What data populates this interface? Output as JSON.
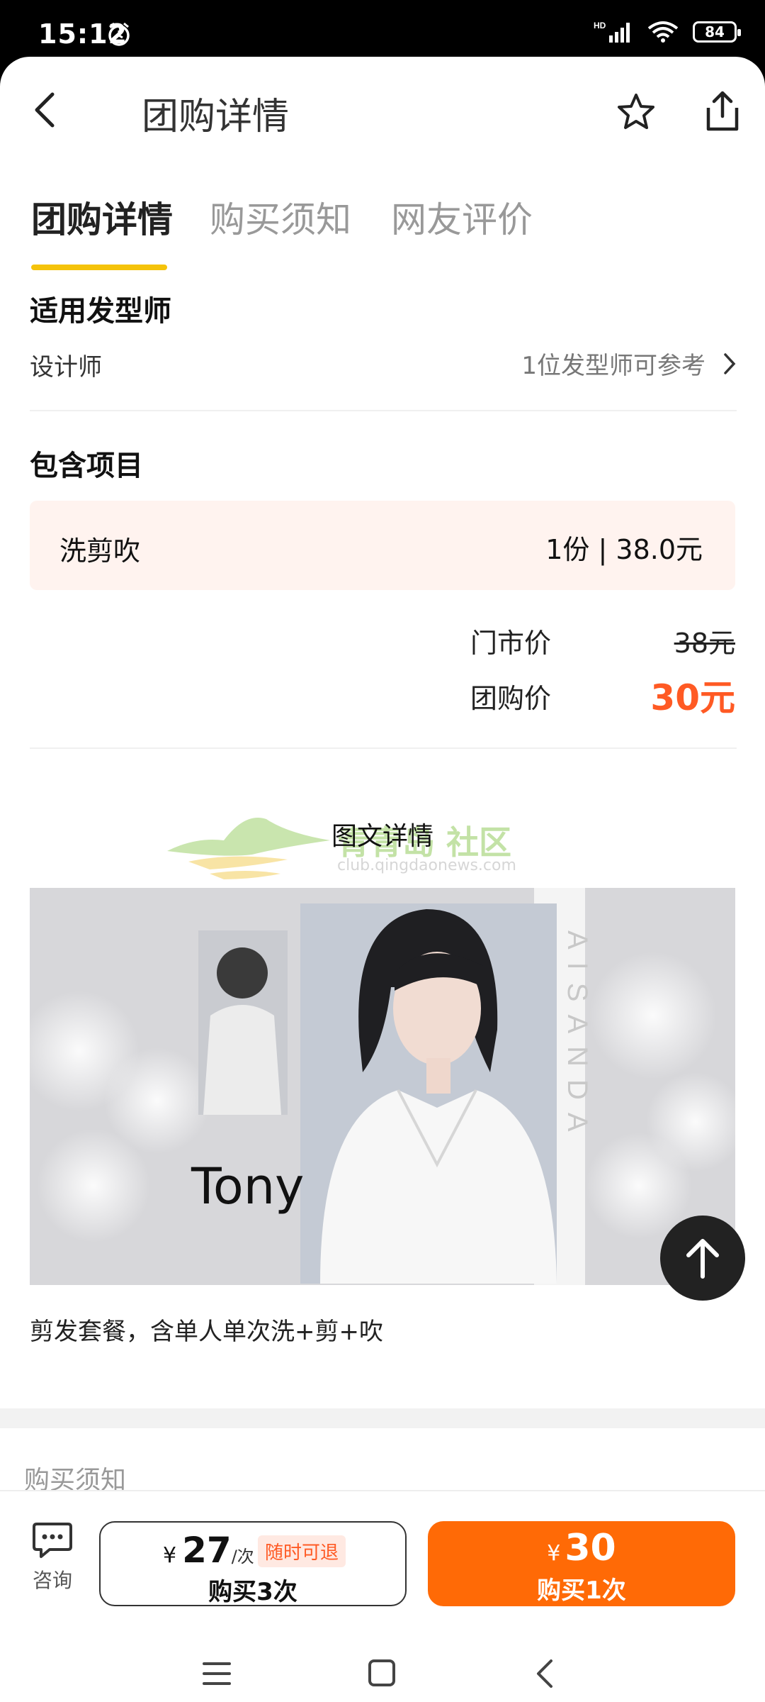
{
  "status": {
    "time": "15:12",
    "network": "HD",
    "battery": "84"
  },
  "header": {
    "title": "团购详情"
  },
  "tabs": [
    {
      "label": "团购详情"
    },
    {
      "label": "购买须知"
    },
    {
      "label": "网友评价"
    }
  ],
  "stylist": {
    "title": "适用发型师",
    "left": "设计师",
    "right": "1位发型师可参考"
  },
  "included": {
    "title": "包含项目",
    "item_name": "洗剪吹",
    "item_qty": "1份 | 38.0元",
    "store_price_label": "门市价",
    "store_price": "38元",
    "group_price_label": "团购价",
    "group_price": "30元"
  },
  "details": {
    "title": "图文详情",
    "watermark_text": "青青岛  社区",
    "watermark_url": "club.qingdaonews.com",
    "image_text": "Tony",
    "caption": "剪发套餐，含单人单次洗+剪+吹"
  },
  "notice": {
    "title": "购买须知"
  },
  "bottom": {
    "consult_label": "咨询",
    "left_currency": "¥",
    "left_price": "27",
    "left_unit": "/次",
    "badge": "随时可退",
    "left_label": "购买3次",
    "right_currency": "¥",
    "right_price": "30",
    "right_label": "购买1次"
  },
  "colors": {
    "accent": "#f5c30b",
    "price": "#ff5a24",
    "cta": "#ff6a06"
  }
}
